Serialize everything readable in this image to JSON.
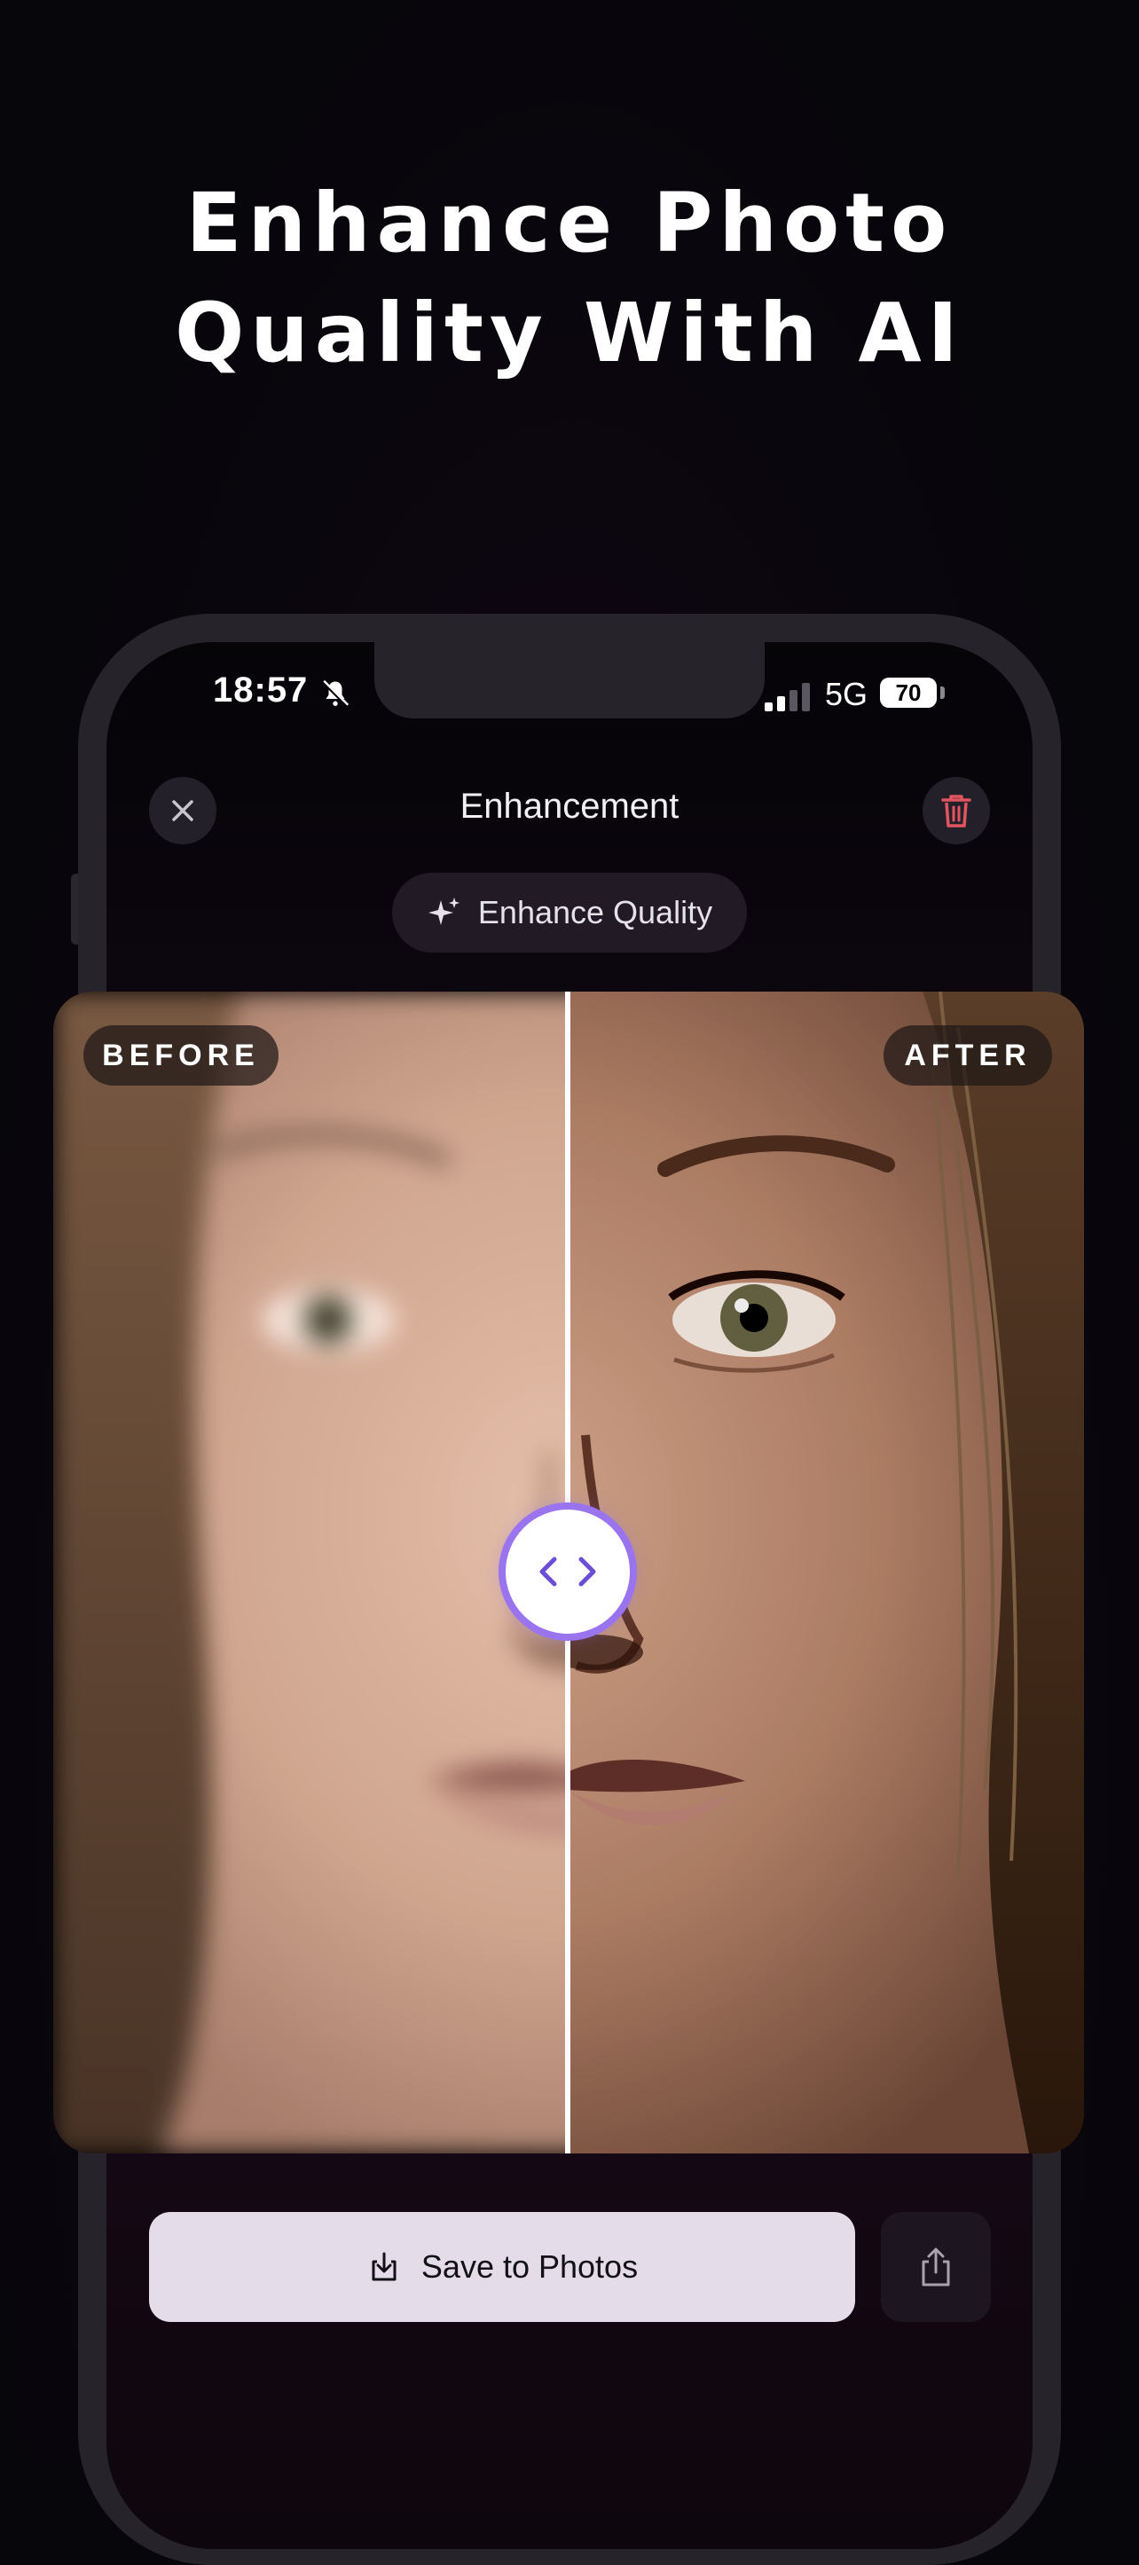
{
  "headline": {
    "line1": "Enhance Photo",
    "line2": "Quality With AI"
  },
  "status_bar": {
    "time": "18:57",
    "network": "5G",
    "battery": "70"
  },
  "nav": {
    "title": "Enhancement",
    "close_icon": "close-icon",
    "trash_icon": "trash-icon"
  },
  "enhance_chip": {
    "label": "Enhance Quality",
    "icon": "sparkles-icon"
  },
  "compare": {
    "before_label": "BEFORE",
    "after_label": "AFTER",
    "slider_position": 0.5,
    "handle_icon": "chevrons-left-right-icon",
    "accent_color": "#9a73ee"
  },
  "actions": {
    "save_label": "Save to Photos",
    "save_icon": "download-icon",
    "share_icon": "share-icon"
  },
  "colors": {
    "delete": "#e25560",
    "save_bg": "#e4dce9"
  }
}
